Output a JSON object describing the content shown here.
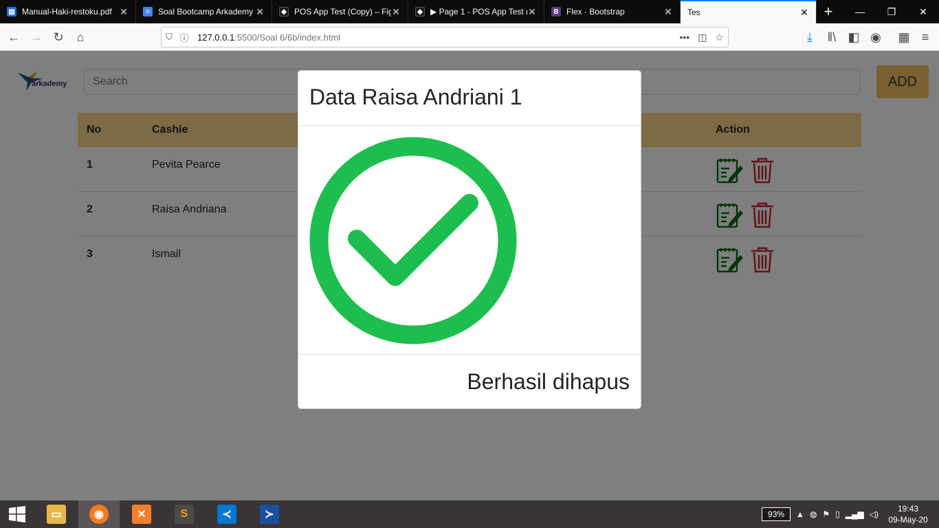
{
  "browser": {
    "tabs": [
      {
        "title": "Manual-Haki-restoku.pdf",
        "favicon": "pdf-icon"
      },
      {
        "title": "Soal Bootcamp Arkademy",
        "favicon": "docs-icon"
      },
      {
        "title": "POS App Test (Copy) – Fig",
        "favicon": "figma-icon"
      },
      {
        "title": "▶ Page 1 - POS App Test (",
        "favicon": "figma-icon"
      },
      {
        "title": "Flex · Bootstrap",
        "favicon": "bootstrap-icon"
      },
      {
        "title": "Tes",
        "favicon": "none"
      }
    ],
    "url_host": "127.0.0.1",
    "url_path": ":5500/Soal 6/6b/index.html"
  },
  "page": {
    "logo_text": "arkademy",
    "search_placeholder": "Search",
    "add_label": "ADD",
    "table": {
      "headers": [
        "No",
        "Cashie",
        "Action"
      ],
      "rows": [
        {
          "no": "1",
          "name": "Pevita Pearce"
        },
        {
          "no": "2",
          "name": "Raisa Andriana"
        },
        {
          "no": "3",
          "name": "Ismail"
        }
      ]
    }
  },
  "modal": {
    "title": "Data Raisa Andriani 1",
    "icon": "check-circle-icon",
    "message": "Berhasil dihapus",
    "accent_color": "#1ebe4e"
  },
  "taskbar": {
    "battery": "93%",
    "time": "19:43",
    "date": "09-May-20"
  },
  "colors": {
    "header_bg": "#fcd68a",
    "add_button": "#f0c060",
    "edit_icon": "#0a6b0a",
    "delete_icon": "#c82333"
  }
}
